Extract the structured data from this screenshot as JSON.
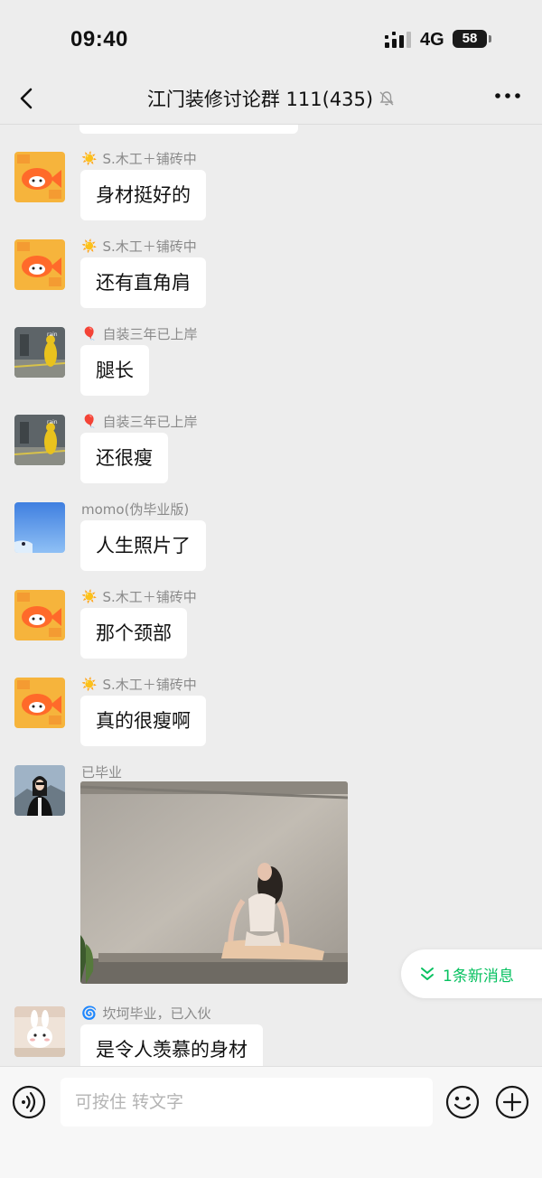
{
  "status_bar": {
    "time": "09:40",
    "network": "4G",
    "battery": "58"
  },
  "nav": {
    "title": "江门装修讨论群 111(435)"
  },
  "messages": [
    {
      "sender": "S.木工＋铺砖中",
      "badge": "☀️",
      "text": "身材挺好的",
      "avatar": "fish-avatar"
    },
    {
      "sender": "S.木工＋铺砖中",
      "badge": "☀️",
      "text": "还有直角肩",
      "avatar": "fish-avatar"
    },
    {
      "sender": "自装三年已上岸",
      "badge": "🎈",
      "text": "腿长",
      "avatar": "yellow-figure-avatar"
    },
    {
      "sender": "自装三年已上岸",
      "badge": "🎈",
      "text": "还很瘦",
      "avatar": "yellow-figure-avatar"
    },
    {
      "sender": "momo(伪毕业版)",
      "badge": "",
      "text": "人生照片了",
      "avatar": "blue-sky-avatar"
    },
    {
      "sender": "S.木工＋铺砖中",
      "badge": "☀️",
      "text": "那个颈部",
      "avatar": "fish-avatar"
    },
    {
      "sender": "S.木工＋铺砖中",
      "badge": "☀️",
      "text": "真的很瘦啊",
      "avatar": "fish-avatar"
    },
    {
      "sender": "已毕业",
      "badge": "",
      "avatar": "woman-avatar"
    },
    {
      "sender": "坎坷毕业，已入伙",
      "badge": "🌀",
      "text": "是令人羡慕的身材",
      "avatar": "bunny-avatar"
    }
  ],
  "new_messages": {
    "label": "1条新消息"
  },
  "input": {
    "placeholder": "可按住 转文字"
  },
  "colors": {
    "accent": "#07c160",
    "background": "#ededed",
    "bubble": "#ffffff"
  }
}
